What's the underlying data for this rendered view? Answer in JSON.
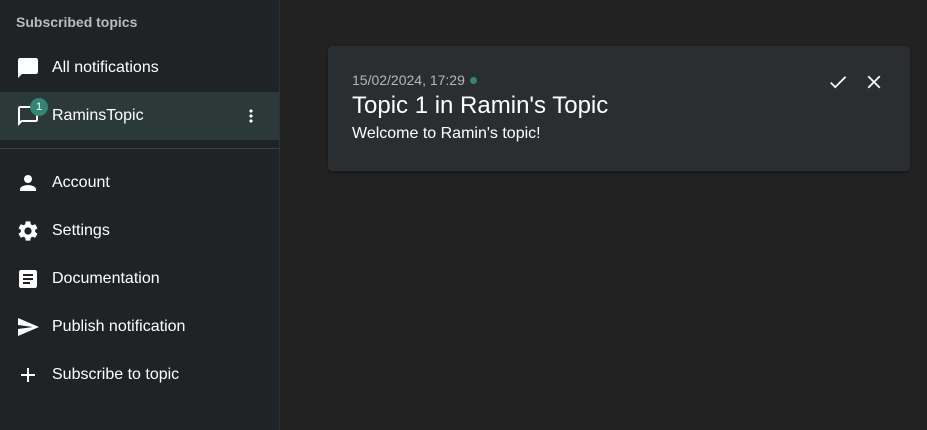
{
  "sidebar": {
    "section_title": "Subscribed topics",
    "topics": [
      {
        "label": "All notifications",
        "icon": "chat-icon"
      },
      {
        "label": "RaminsTopic",
        "icon": "chat-outline-icon",
        "badge": "1",
        "selected": true
      }
    ],
    "nav": [
      {
        "label": "Account",
        "icon": "person-icon"
      },
      {
        "label": "Settings",
        "icon": "gear-icon"
      },
      {
        "label": "Documentation",
        "icon": "article-icon"
      },
      {
        "label": "Publish notification",
        "icon": "send-icon"
      },
      {
        "label": "Subscribe to topic",
        "icon": "plus-icon"
      }
    ]
  },
  "notification": {
    "timestamp": "15/02/2024, 17:29",
    "title": "Topic 1 in Ramin's Topic",
    "message": "Welcome to Ramin's topic!",
    "unread": true
  },
  "colors": {
    "accent": "#338574",
    "sidebar_bg": "#1f2326",
    "main_bg": "#222222",
    "card_bg": "#2a2e31",
    "selected_bg": "#2b3a39"
  }
}
